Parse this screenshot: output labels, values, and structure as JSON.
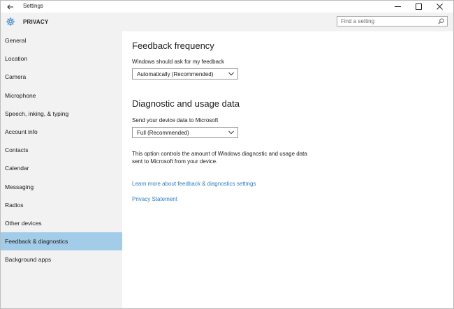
{
  "window": {
    "title": "Settings",
    "controls": {
      "minimize": "–",
      "maximize": "☐",
      "close": "✕"
    }
  },
  "header": {
    "label": "PRIVACY"
  },
  "search": {
    "placeholder": "Find a setting"
  },
  "sidebar": {
    "items": [
      {
        "label": "General",
        "selected": false
      },
      {
        "label": "Location",
        "selected": false
      },
      {
        "label": "Camera",
        "selected": false
      },
      {
        "label": "Microphone",
        "selected": false
      },
      {
        "label": "Speech, inking, & typing",
        "selected": false
      },
      {
        "label": "Account info",
        "selected": false
      },
      {
        "label": "Contacts",
        "selected": false
      },
      {
        "label": "Calendar",
        "selected": false
      },
      {
        "label": "Messaging",
        "selected": false
      },
      {
        "label": "Radios",
        "selected": false
      },
      {
        "label": "Other devices",
        "selected": false
      },
      {
        "label": "Feedback & diagnostics",
        "selected": true
      },
      {
        "label": "Background apps",
        "selected": false
      }
    ]
  },
  "main": {
    "feedback": {
      "heading": "Feedback frequency",
      "label": "Windows should ask for my feedback",
      "value": "Automatically (Recommended)"
    },
    "diagnostics": {
      "heading": "Diagnostic and usage data",
      "label": "Send your device data to Microsoft",
      "value": "Full (Recommended)",
      "description": "This option controls the amount of Windows diagnostic and usage data sent to Microsoft from your device."
    },
    "links": {
      "learn_more": "Learn more about feedback & diagnostics settings",
      "privacy": "Privacy Statement"
    }
  },
  "colors": {
    "accent": "#2b7cc4",
    "selected_bg": "#a3cce8",
    "pane_bg": "#f2f2f2"
  }
}
